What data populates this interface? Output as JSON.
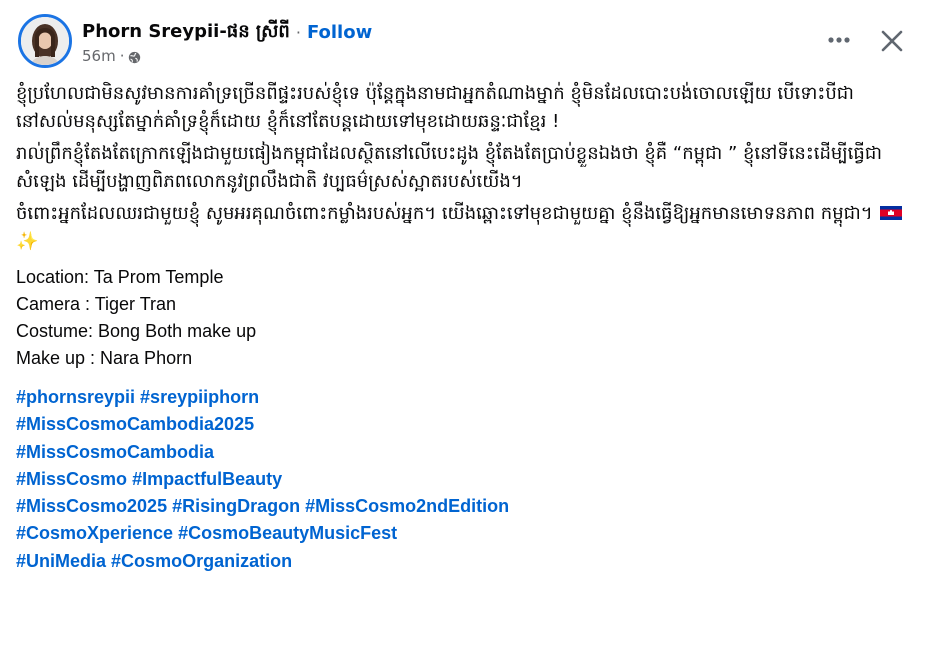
{
  "post": {
    "author": "Phorn Sreypii-ផន ស្រីពី",
    "separator": "·",
    "follow_label": "Follow",
    "time": "56m",
    "meta_separator": "·",
    "privacy_icon": "globe-icon",
    "more_icon": "more-options-icon",
    "close_icon": "close-icon"
  },
  "content": {
    "paragraph1": "ខ្ញុំប្រហែលជាមិនសូវមានការគាំទ្រច្រើនពីផ្ទះរបស់ខ្ញុំទេ ប៉ុន្តែក្នុងនាមជាអ្នកតំណាងម្នាក់ ខ្ញុំមិនដែលបោះបង់ចោលឡើយ បើទោះបីជានៅសល់មនុស្សតែម្នាក់គាំទ្រខ្ញុំក៏ដោយ ខ្ញុំក៏នៅតែបន្តដោយទៅមុខដោយឆន្ទៈជាខ្មែរ !",
    "paragraph2": "រាល់ព្រឹកខ្ញុំតែងតែក្រោកឡើងជាមួយផៀងកម្ពុជាដែលស្ថិតនៅលើបេះដូង ខ្ញុំតែងតែប្រាប់ខ្លួនឯងថា ខ្ញុំគឺ “កម្ពុជា ” ខ្ញុំនៅទីនេះដើម្បីធ្វើជាសំឡេង ដើម្បីបង្ហាញពិភពលោកនូវព្រលឹងជាតិ វប្បធម៌ស្រស់ស្អាតរបស់យើង។",
    "paragraph3": "ចំពោះអ្នកដែលឈរជាមួយខ្ញុំ សូមអរគុណចំពោះកម្លាំងរបស់អ្នក។ យើងឆ្ពោះទៅមុខជាមួយគ្នា ខ្ញុំនឹងធ្វើឱ្យអ្នកមានមោទនភាព កម្ពុជា។",
    "paragraph3_emoji": [
      "cambodia-flag-icon",
      "sparkles-icon"
    ],
    "credits": [
      "Location: Ta Prom Temple",
      "Camera : Tiger Tran",
      "Costume: Bong Both make up",
      "Make up : Nara Phorn"
    ],
    "hashtag_lines": [
      [
        "#phornsreypii",
        "#sreypiiphorn"
      ],
      [
        "#MissCosmoCambodia2025"
      ],
      [
        "#MissCosmoCambodia"
      ],
      [
        "#MissCosmo",
        "#ImpactfulBeauty"
      ],
      [
        "#MissCosmo2025",
        "#RisingDragon",
        "#MissCosmo2ndEdition"
      ],
      [
        "#CosmoXperience",
        "#CosmoBeautyMusicFest"
      ],
      [
        "#UniMedia",
        "#CosmoOrganization"
      ]
    ]
  },
  "colors": {
    "link": "#0064d1",
    "text": "#080809",
    "secondary": "#65676b",
    "avatar_ring": "#1b74e4"
  }
}
